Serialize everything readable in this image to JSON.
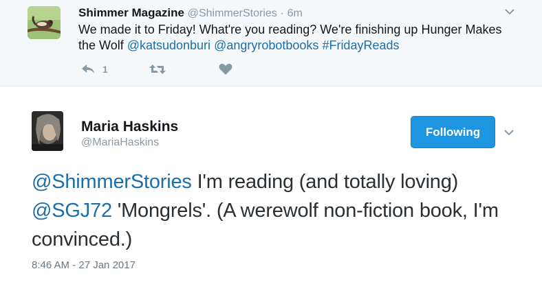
{
  "parent_tweet": {
    "display_name": "Shimmer Magazine",
    "handle": "@ShimmerStories",
    "separator": "·",
    "time": "6m",
    "text_before": "We made it to Friday! What're you reading? We're finishing up Hunger Makes the Wolf ",
    "mention_1": "@katsudonburi",
    "mention_2": "@angryrobotbooks",
    "hashtag": "#FridayReads",
    "reply_count": "1",
    "avatar_icon": "chipmunk-on-branch-photo",
    "background": "#f5f8fa"
  },
  "main_tweet": {
    "display_name": "Maria Haskins",
    "handle": "@MariaHaskins",
    "follow_button_label": "Following",
    "mention_1": "@ShimmerStories",
    "text_1": " I'm reading (and totally loving) ",
    "mention_2": "@SGJ72",
    "text_2": " 'Mongrels'. (A werewolf non-fiction book, I'm convinced.)",
    "timestamp": "8:46 AM - 27 Jan 2017",
    "avatar_icon": "profile-photo",
    "follow_button_color": "#1e95e0"
  },
  "colors": {
    "link": "#1b6ea9",
    "muted": "#8899a6"
  }
}
